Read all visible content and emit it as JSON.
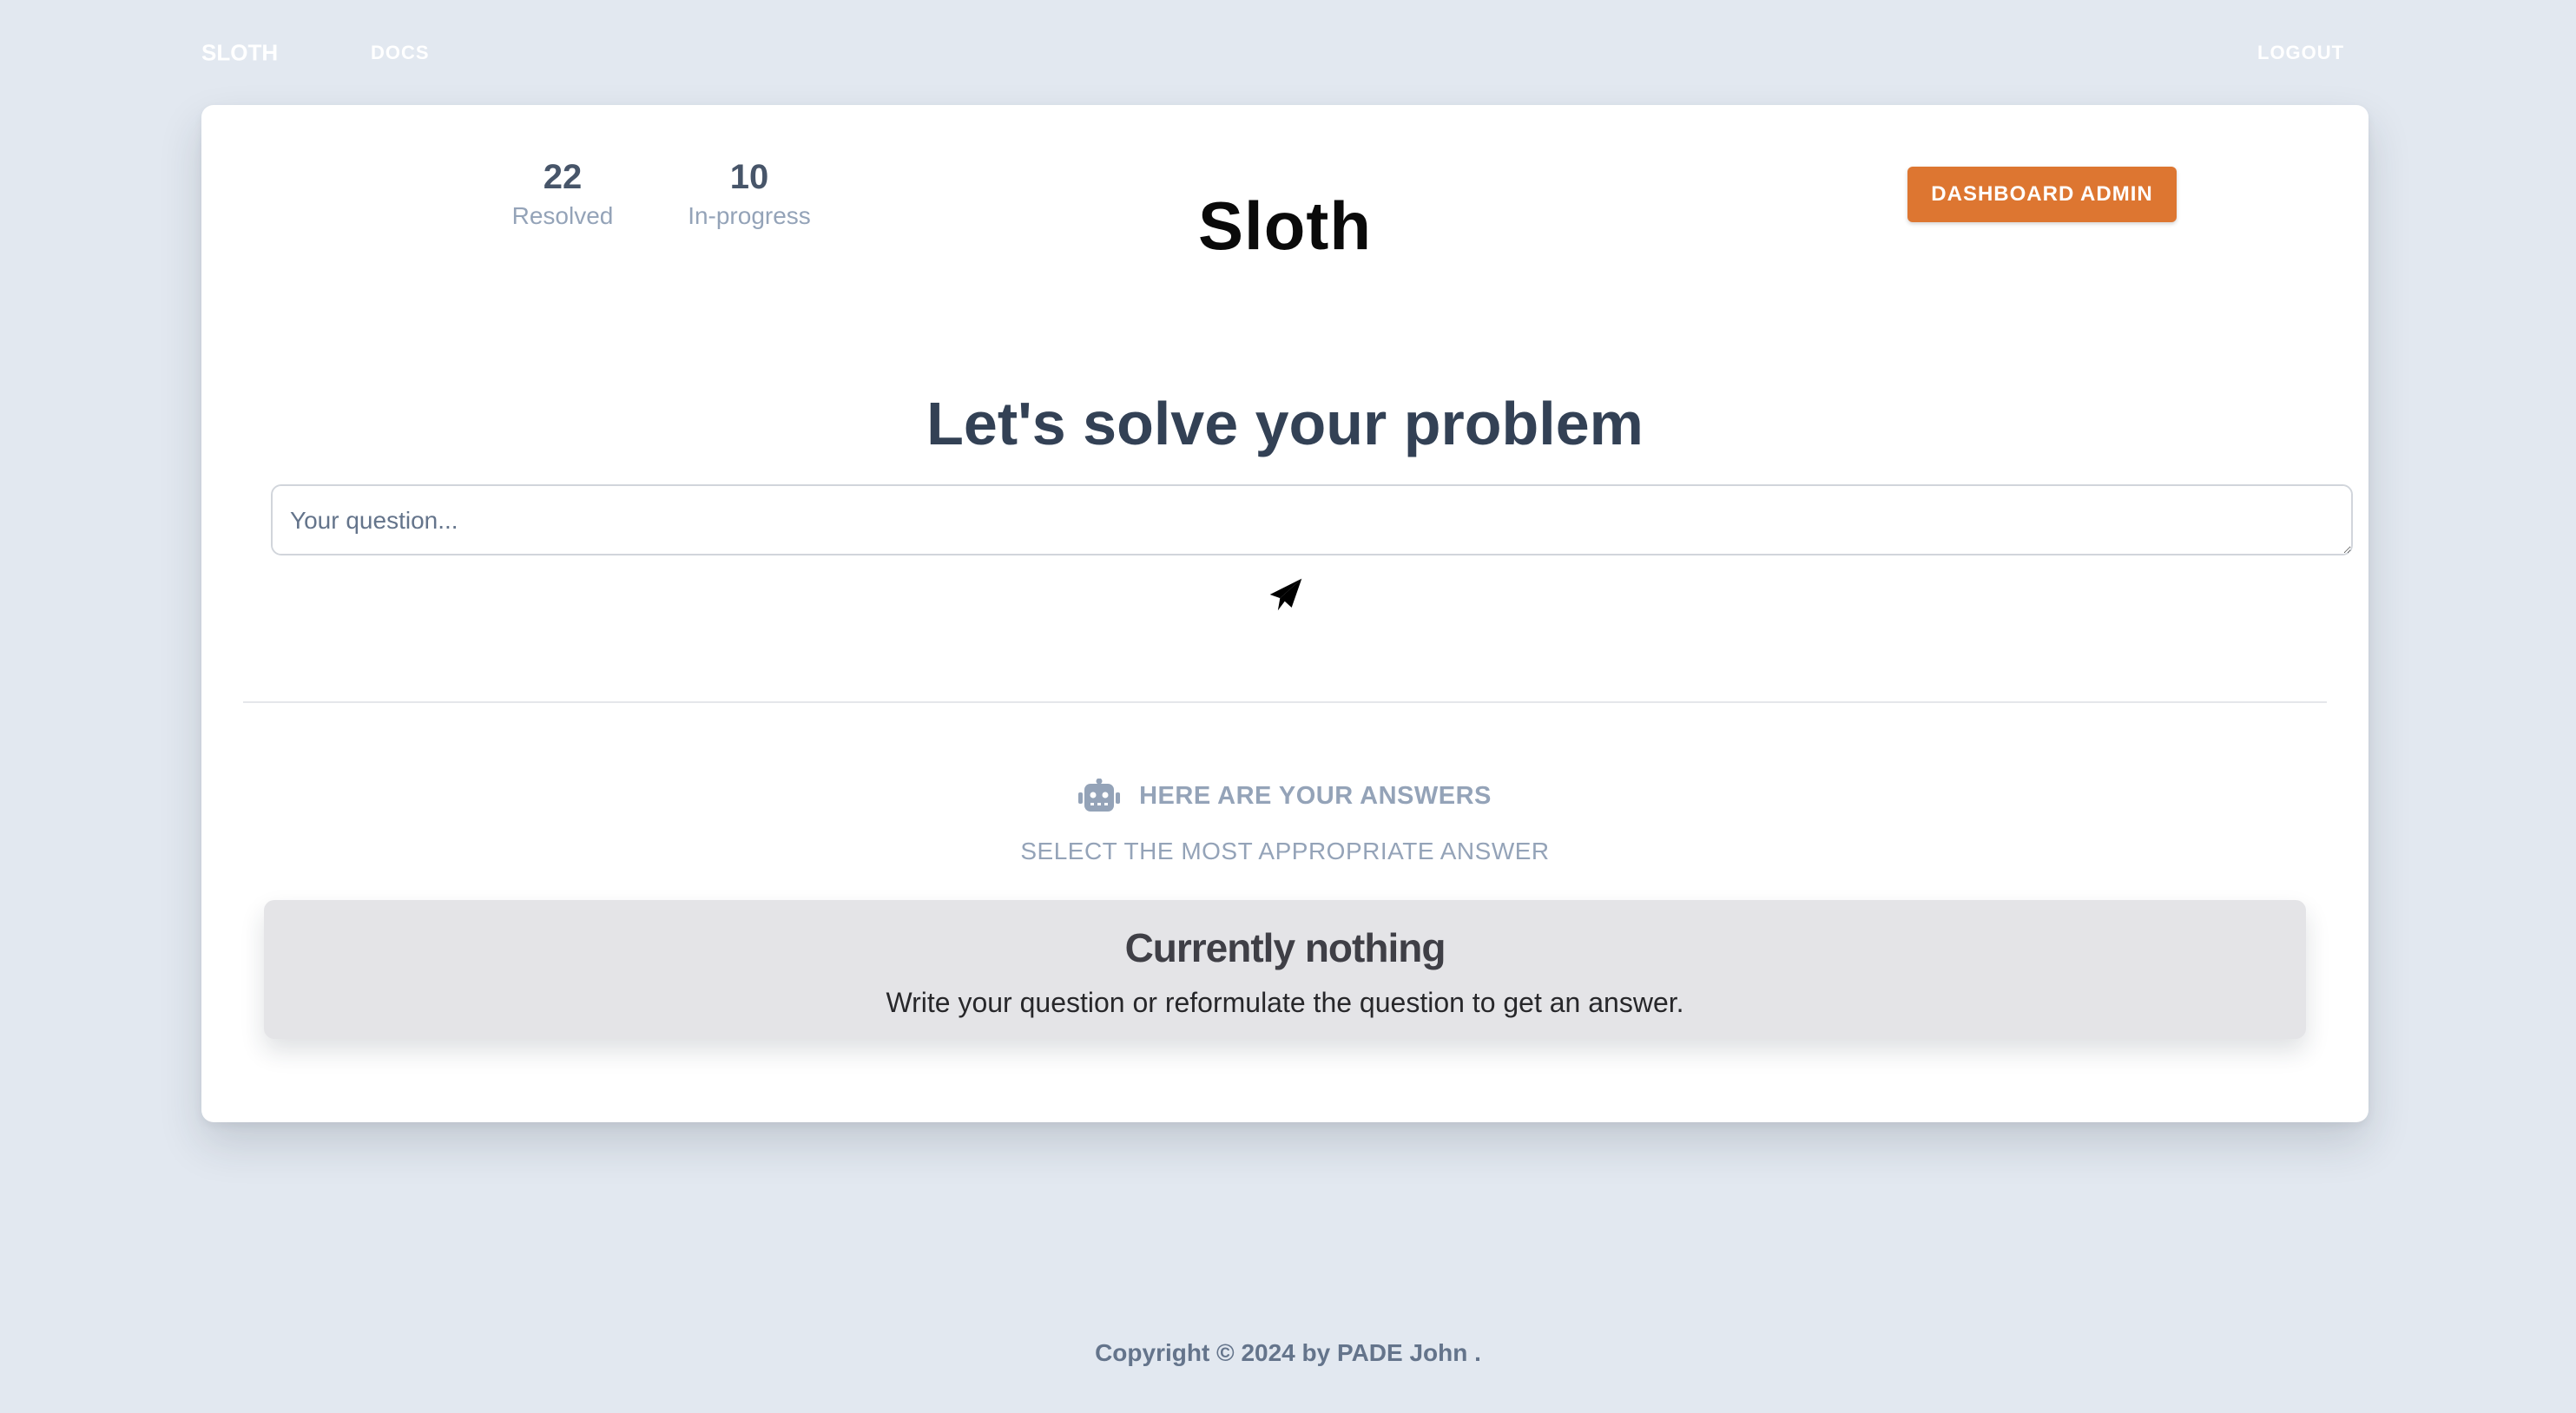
{
  "nav": {
    "brand": "SLOTH",
    "docs": "DOCS",
    "logout": "LOGOUT"
  },
  "stats": {
    "resolved": {
      "value": "22",
      "label": "Resolved"
    },
    "in_progress": {
      "value": "10",
      "label": "In-progress"
    }
  },
  "logo": "Sloth",
  "admin_button": "DASHBOARD ADMIN",
  "headline": "Let's solve your problem",
  "question": {
    "placeholder": "Your question...",
    "value": ""
  },
  "icons": {
    "send": "paper-plane-icon",
    "answers": "robot-icon"
  },
  "answers": {
    "title": "HERE ARE YOUR ANSWERS",
    "subtitle": "SELECT THE MOST APPROPRIATE ANSWER",
    "empty_title": "Currently nothing",
    "empty_text": "Write your question or reformulate the question to get an answer."
  },
  "footer": "Copyright © 2024 by PADE John .",
  "colors": {
    "background": "#e2e8f0",
    "card": "#ffffff",
    "accent": "#dd7631",
    "heading": "#334155",
    "muted": "#94a3b8",
    "empty_card": "#e4e4e7"
  }
}
